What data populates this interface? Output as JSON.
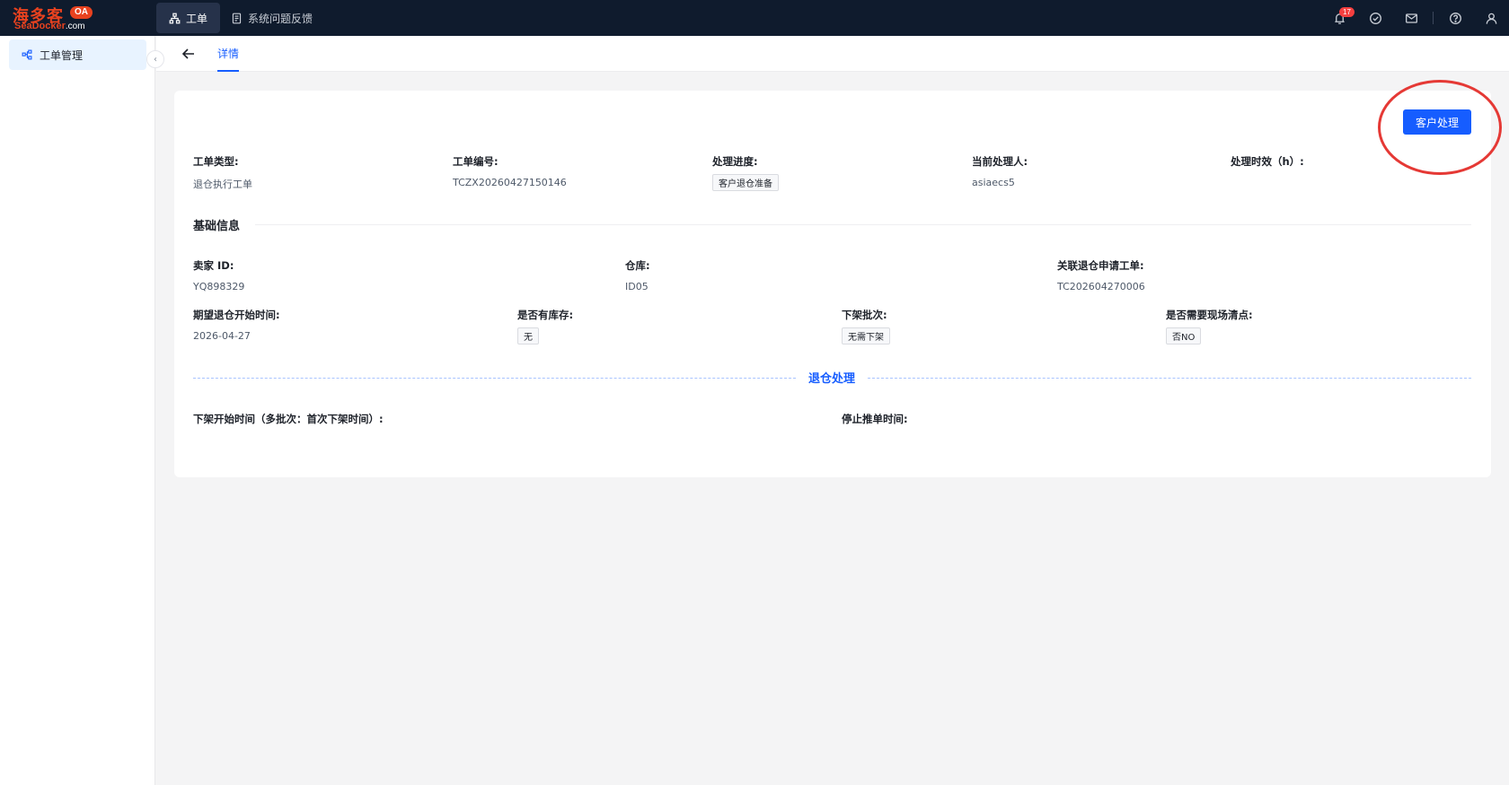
{
  "app": {
    "logo_cn": "海多客",
    "logo_en": "SeaDocker",
    "logo_domain": ".com",
    "logo_badge": "OA"
  },
  "topnav": {
    "tabs": [
      {
        "label": "工单",
        "icon": "org-tree-icon",
        "active": true
      },
      {
        "label": "系统问题反馈",
        "icon": "document-icon",
        "active": false
      }
    ],
    "notification_count": "17"
  },
  "sidebar": {
    "items": [
      {
        "label": "工单管理",
        "icon": "flow-icon",
        "active": true
      }
    ]
  },
  "subheader": {
    "tab": "详情"
  },
  "detail": {
    "action_button": "客户处理",
    "summary": [
      {
        "label": "工单类型:",
        "value": "退仓执行工单",
        "type": "text"
      },
      {
        "label": "工单编号:",
        "value": "TCZX20260427150146",
        "type": "text"
      },
      {
        "label": "处理进度:",
        "value": "客户退仓准备",
        "type": "tag"
      },
      {
        "label": "当前处理人:",
        "value": "asiaecs5",
        "type": "text"
      },
      {
        "label": "处理时效（h）:",
        "value": "",
        "type": "text"
      }
    ],
    "basic_title": "基础信息",
    "basic_row1": [
      {
        "label": "卖家 ID:",
        "value": "YQ898329",
        "type": "text"
      },
      {
        "label": "仓库:",
        "value": "ID05",
        "type": "text"
      },
      {
        "label": "关联退仓申请工单:",
        "value": "TC202604270006",
        "type": "text"
      }
    ],
    "basic_row2": [
      {
        "label": "期望退仓开始时间:",
        "value": "2026-04-27",
        "type": "text"
      },
      {
        "label": "是否有库存:",
        "value": "无",
        "type": "tag"
      },
      {
        "label": "下架批次:",
        "value": "无需下架",
        "type": "tag"
      },
      {
        "label": "是否需要现场清点:",
        "value": "否NO",
        "type": "tag"
      }
    ],
    "process_title": "退仓处理",
    "process_fields": [
      {
        "label": "下架开始时间（多批次：首次下架时间）:",
        "value": ""
      },
      {
        "label": "停止推单时间:",
        "value": ""
      }
    ]
  },
  "colors": {
    "topbar": "#0f1b2d",
    "primary": "#165dff",
    "highlight_ring": "#e53935",
    "logo": "#e8421f"
  }
}
